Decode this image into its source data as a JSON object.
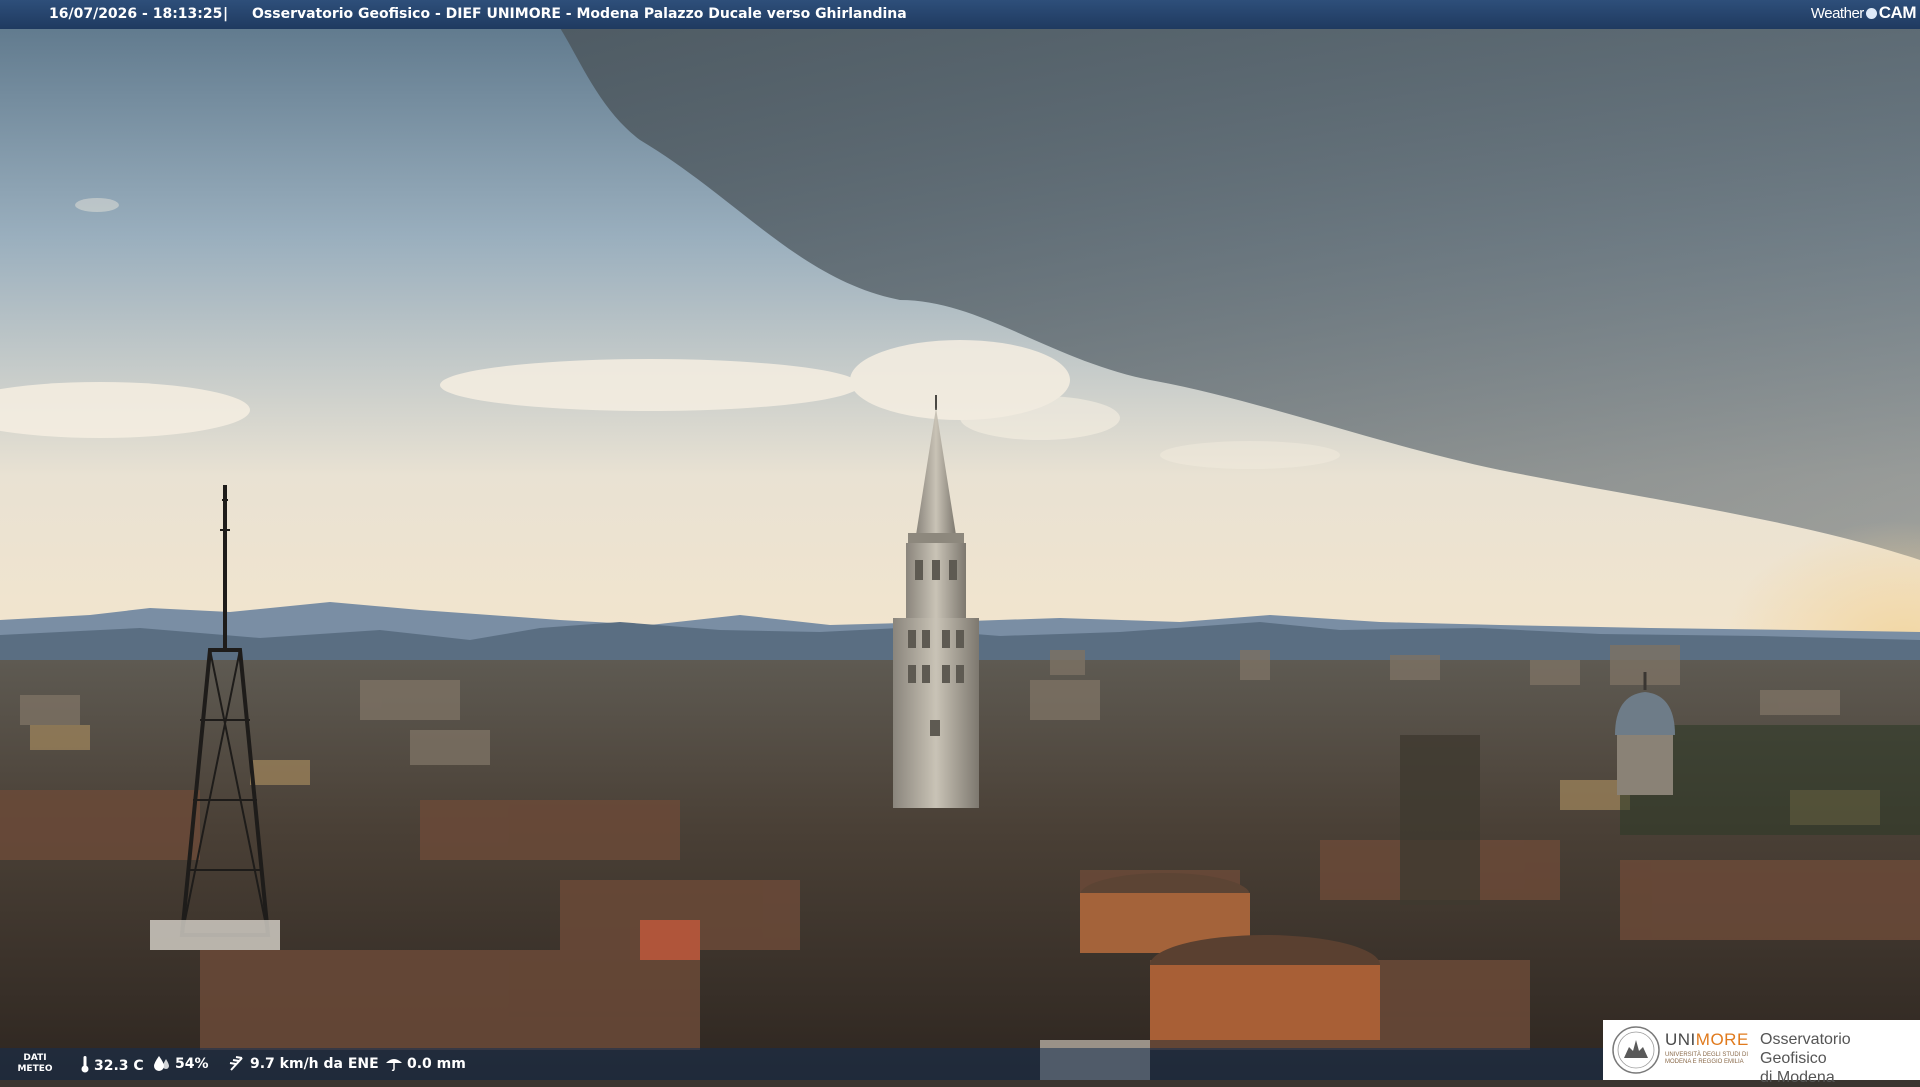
{
  "header": {
    "timestamp": "16/07/2026 - 18:13:25",
    "separator": "|",
    "title": "Osservatorio Geofisico - DIEF UNIMORE - Modena Palazzo Ducale verso Ghirlandina",
    "brand_weather": "Weather",
    "brand_cam": "CAM"
  },
  "weather": {
    "label_line1": "DATI",
    "label_line2": "METEO",
    "temperature": "32.3 C",
    "humidity": "54%",
    "wind": "9.7 km/h da ENE",
    "rain": "0.0 mm",
    "icons": [
      "thermometer-icon",
      "humidity-icon",
      "wind-icon",
      "rain-icon"
    ]
  },
  "logo": {
    "uni_part": "UNI",
    "more_part": "MORE",
    "subtitle_line1": "UNIVERSITÀ DEGLI STUDI DI",
    "subtitle_line2": "MODENA E REGGIO EMILIA",
    "observatory_line1": "Osservatorio Geofisico",
    "observatory_line2": "di Modena"
  },
  "colors": {
    "topbar": "#26446d",
    "logo_accent": "#e07a1d",
    "sky_storm": "#4a5864",
    "sky_light": "#f1e6d2"
  }
}
